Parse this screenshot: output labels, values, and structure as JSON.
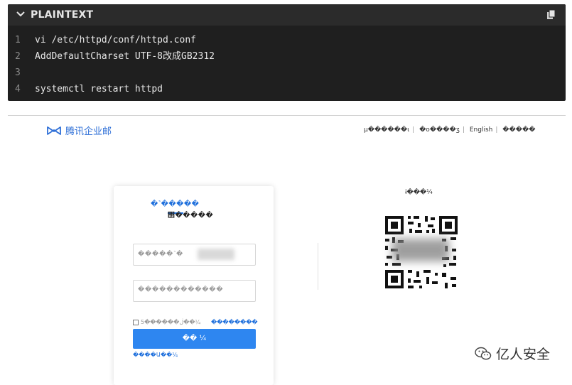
{
  "code_block": {
    "language": "PLAINTEXT",
    "copy_icon": "copy-icon",
    "lines": [
      {
        "number": "1",
        "text": "vi /etc/httpd/conf/httpd.conf"
      },
      {
        "number": "2",
        "text": "AddDefaultCharset UTF-8改成GB2312"
      },
      {
        "number": "3",
        "text": ""
      },
      {
        "number": "4",
        "text": "systemctl restart httpd"
      }
    ]
  },
  "login_page": {
    "brand": "腾讯企业邮",
    "top_nav": {
      "item1": "μ������ι",
      "item2": "�ο����ʒ",
      "item3": "English",
      "item4": "�����"
    },
    "tabs": {
      "tab_a": "�˺�����",
      "tab_b": "΢�����"
    },
    "account_placeholder": "�����˺�",
    "password_placeholder": "������������",
    "remember_label": "5������ڶ��¼",
    "forgot_link": "��������",
    "login_button": "�� ¼",
    "help_link": "����Ա��¼",
    "qr_title": "ɨ���¼"
  },
  "watermark": {
    "text": "亿人安全",
    "icon": "wechat-icon"
  },
  "colors": {
    "code_bg": "#1f1f1f",
    "code_header_bg": "#2b2b2b",
    "link_blue": "#1e6fdc",
    "button_blue": "#2e86f0"
  }
}
